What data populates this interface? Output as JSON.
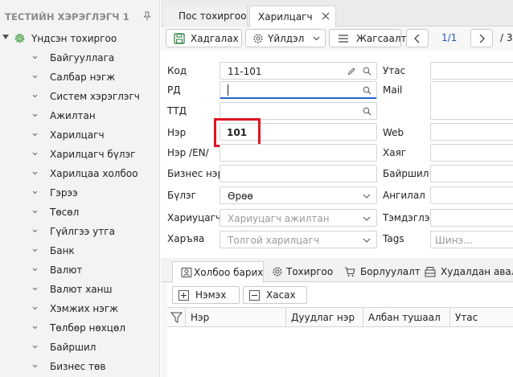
{
  "sidebar": {
    "title": "ТЕСТИЙН ХЭРЭГЛЭГЧ 1",
    "root_label": "Үндсэн тохиргоо",
    "items": [
      {
        "label": "Байгууллага"
      },
      {
        "label": "Салбар нэгж"
      },
      {
        "label": "Систем хэрэглэгч"
      },
      {
        "label": "Ажилтан"
      },
      {
        "label": "Харилцагч"
      },
      {
        "label": "Харилцагч бүлэг"
      },
      {
        "label": "Харилцаа холбоо"
      },
      {
        "label": "Гэрээ"
      },
      {
        "label": "Төсөл"
      },
      {
        "label": "Гүйлгээ утга"
      },
      {
        "label": "Банк"
      },
      {
        "label": "Валют"
      },
      {
        "label": "Валют ханш"
      },
      {
        "label": "Хэмжих нэгж"
      },
      {
        "label": "Төлбөр нөхцөл"
      },
      {
        "label": "Байршил"
      },
      {
        "label": "Бизнес төв"
      }
    ]
  },
  "tabs": [
    {
      "label": "Пос тохиргоо"
    },
    {
      "label": "Харилцагч"
    }
  ],
  "toolbar": {
    "save_label": "Хадгалах",
    "action_label": "Үйлдэл",
    "sort_label": "Жагсаалт",
    "page_current": "1/1",
    "page_total": "/ 3"
  },
  "form": {
    "left": [
      {
        "label": "Код",
        "value": "11-101"
      },
      {
        "label": "РД",
        "value": ""
      },
      {
        "label": "ТТД",
        "value": ""
      },
      {
        "label": "Нэр",
        "value": "101"
      },
      {
        "label": "Нэр /EN/",
        "value": ""
      },
      {
        "label": "Бизнес нэр",
        "value": ""
      },
      {
        "label": "Бүлэг",
        "value": "Өрөө"
      },
      {
        "label": "Хариуцагч",
        "placeholder": "Хариуцагч ажилтан"
      },
      {
        "label": "Харъяа",
        "placeholder": "Толгой харилцагч"
      }
    ],
    "right": [
      {
        "label": "Утас"
      },
      {
        "label": "Mail"
      },
      {
        "label": "Web"
      },
      {
        "label": "Хаяг"
      },
      {
        "label": "Байршил"
      },
      {
        "label": "Ангилал"
      },
      {
        "label": "Тэмдэглэл"
      },
      {
        "label": "Tags",
        "placeholder": "Шинэ..."
      }
    ]
  },
  "bottom_tabs": [
    {
      "label": "Холбоо барих",
      "icon": "contact-card-icon"
    },
    {
      "label": "Тохиргоо",
      "icon": "gear-icon"
    },
    {
      "label": "Борлуулалт",
      "icon": "cart-icon"
    },
    {
      "label": "Худалдан авалт",
      "icon": "register-icon"
    }
  ],
  "subbar": {
    "add_label": "Нэмэх",
    "delete_label": "Хасах"
  },
  "grid": {
    "columns": [
      "Нэр",
      "Дуудлаг нэр",
      "Албан тушаал",
      "Утас"
    ]
  },
  "colors": {
    "accent": "#1a56c2",
    "highlight": "#e0141e",
    "focus": "#2a63c9",
    "cog_green": "#3a9a3a"
  }
}
